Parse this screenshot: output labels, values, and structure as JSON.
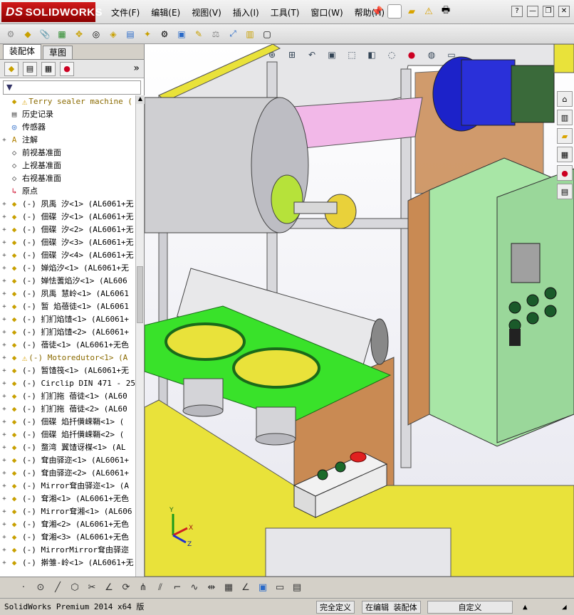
{
  "app": {
    "logo_prefix": "DS",
    "logo_text": "SOLIDWORKS"
  },
  "menu": [
    "文件(F)",
    "编辑(E)",
    "视图(V)",
    "插入(I)",
    "工具(T)",
    "窗口(W)",
    "帮助(H)"
  ],
  "window_controls": {
    "help": "?",
    "minimize": "—",
    "restore": "❐",
    "close": "✕"
  },
  "left_panel": {
    "tabs": [
      "装配体",
      "草图"
    ],
    "more": "»",
    "filter": "▼"
  },
  "tree": [
    {
      "text": "Terry sealer machine  (",
      "exp": "",
      "kind": "root",
      "warn": true
    },
    {
      "text": "历史记录",
      "exp": "",
      "kind": "folder"
    },
    {
      "text": "传感器",
      "exp": "",
      "kind": "sensor"
    },
    {
      "text": "注解",
      "exp": "+",
      "kind": "annot"
    },
    {
      "text": "前视基准面",
      "exp": "",
      "kind": "plane"
    },
    {
      "text": "上视基准面",
      "exp": "",
      "kind": "plane"
    },
    {
      "text": "右视基准面",
      "exp": "",
      "kind": "plane"
    },
    {
      "text": "原点",
      "exp": "",
      "kind": "origin"
    },
    {
      "text": "(-) 夙禹 汐<1> (AL6061+无",
      "exp": "+",
      "kind": "part"
    },
    {
      "text": "(-) 佃碟 汐<1> (AL6061+无",
      "exp": "+",
      "kind": "part"
    },
    {
      "text": "(-) 佃碟 汐<2> (AL6061+无",
      "exp": "+",
      "kind": "part"
    },
    {
      "text": "(-) 佃碟 汐<3> (AL6061+无",
      "exp": "+",
      "kind": "part"
    },
    {
      "text": "(-) 佃碟 汐<4> (AL6061+无",
      "exp": "+",
      "kind": "part"
    },
    {
      "text": "(-) 婵焰汐<1> (AL6061+无",
      "exp": "+",
      "kind": "part"
    },
    {
      "text": "(-) 婵怯蓍焰汐<1> (AL606",
      "exp": "+",
      "kind": "part"
    },
    {
      "text": "(-) 夙禹 慧岭<1> (AL6061",
      "exp": "+",
      "kind": "part"
    },
    {
      "text": "(-) 暂 焰蓓徒<1> (AL6061",
      "exp": "+",
      "kind": "part"
    },
    {
      "text": "(-) 扪扪焰馇<1> (AL6061+",
      "exp": "+",
      "kind": "part"
    },
    {
      "text": "(-) 扪扪焰馇<2> (AL6061+",
      "exp": "+",
      "kind": "part"
    },
    {
      "text": "(-) 蓓徒<1> (AL6061+无色",
      "exp": "+",
      "kind": "part"
    },
    {
      "text": "(-) Motoredutor<1> (A",
      "exp": "+",
      "kind": "part",
      "warn": true
    },
    {
      "text": "(-) 暂馇筏<1> (AL6061+无",
      "exp": "+",
      "kind": "part"
    },
    {
      "text": "(-) Circlip DIN 471 - 25",
      "exp": "+",
      "kind": "part"
    },
    {
      "text": "(-) 扪扪拖 蓓徒<1> (AL60",
      "exp": "+",
      "kind": "part"
    },
    {
      "text": "(-) 扪扪拖 蓓徒<2> (AL60",
      "exp": "+",
      "kind": "part"
    },
    {
      "text": "(-) 佃碟 焰扦僙嵘鞘<1> (",
      "exp": "+",
      "kind": "part"
    },
    {
      "text": "(-) 佃碟 焰扦僙嵘鞘<2> (",
      "exp": "+",
      "kind": "part"
    },
    {
      "text": "(-) 蝥湾 翼馇讶楳<1> (AL",
      "exp": "+",
      "kind": "part"
    },
    {
      "text": "(-) 耷由驿迩<1> (AL6061+",
      "exp": "+",
      "kind": "part"
    },
    {
      "text": "(-) 耷由驿迩<2> (AL6061+",
      "exp": "+",
      "kind": "part"
    },
    {
      "text": "(-) Mirror耷由驿迩<1> (A",
      "exp": "+",
      "kind": "part"
    },
    {
      "text": "(-) 耷湘<1> (AL6061+无色",
      "exp": "+",
      "kind": "part"
    },
    {
      "text": "(-) Mirror耷湘<1> (AL606",
      "exp": "+",
      "kind": "part"
    },
    {
      "text": "(-) 耷湘<2> (AL6061+无色",
      "exp": "+",
      "kind": "part"
    },
    {
      "text": "(-) 耷湘<3> (AL6061+无色",
      "exp": "+",
      "kind": "part"
    },
    {
      "text": "(-) MirrorMirror耷由驿迩",
      "exp": "+",
      "kind": "part"
    },
    {
      "text": "(-) 擀雏-岭<1> (AL6061+无",
      "exp": "+",
      "kind": "part"
    }
  ],
  "triad": {
    "x": "X",
    "y": "Y",
    "z": "Z"
  },
  "status": {
    "product": "SolidWorks Premium 2014 x64 版",
    "defined": "完全定义",
    "editing": "在编辑 装配体",
    "units": "自定义"
  },
  "colors": {
    "logo_red": "#c41212",
    "tray_green": "#39e22a",
    "frame_yellow": "#e9e23a",
    "panel_brown": "#c98a53",
    "cabinet_green": "#a8e6a6",
    "motor_blue": "#1c22c9",
    "roller_grey": "#cfcfd2",
    "plate_pink": "#f2b8e8",
    "stop_red": "#e02020"
  }
}
